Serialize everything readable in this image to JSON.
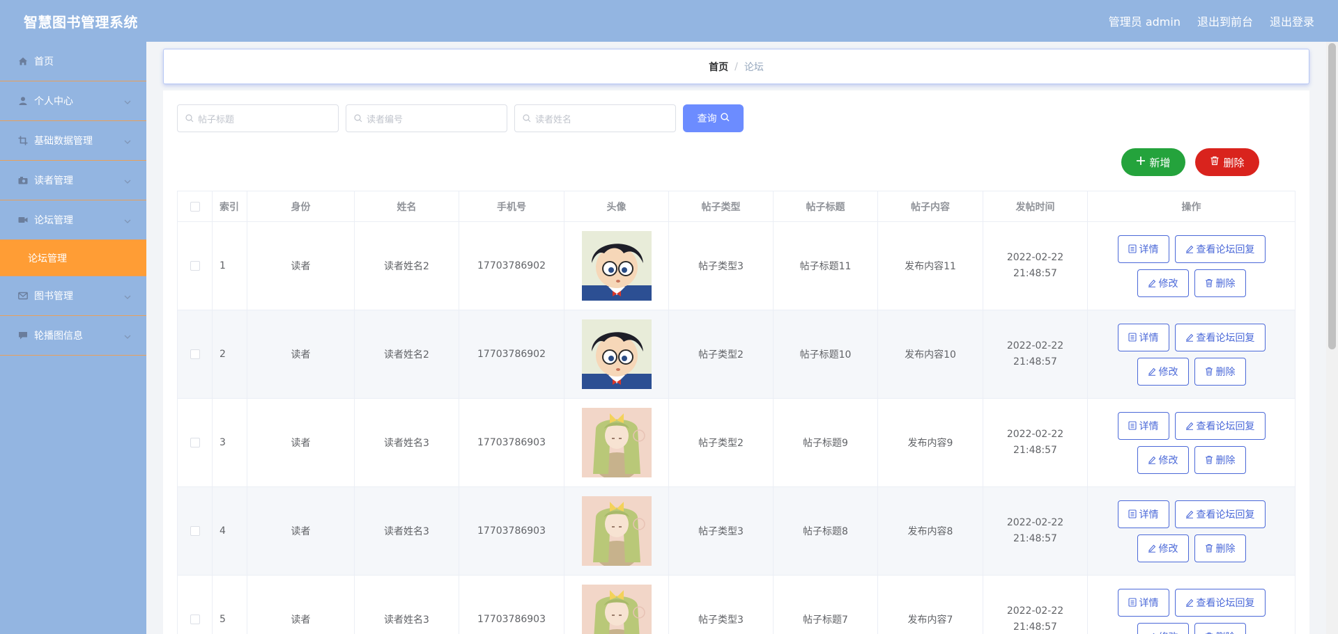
{
  "header": {
    "brand": "智慧图书管理系统",
    "admin": "管理员 admin",
    "front": "退出到前台",
    "logout": "退出登录"
  },
  "sidebar": {
    "items": [
      {
        "label": "首页",
        "icon": "home-icon",
        "has_chevron": false
      },
      {
        "label": "个人中心",
        "icon": "user-icon",
        "has_chevron": true
      },
      {
        "label": "基础数据管理",
        "icon": "crop-icon",
        "has_chevron": true
      },
      {
        "label": "读者管理",
        "icon": "camera-icon",
        "has_chevron": true
      },
      {
        "label": "论坛管理",
        "icon": "video-icon",
        "has_chevron": true
      },
      {
        "label": "图书管理",
        "icon": "mail-icon",
        "has_chevron": true
      },
      {
        "label": "轮播图信息",
        "icon": "chat-icon",
        "has_chevron": true
      }
    ],
    "active_sub": "论坛管理"
  },
  "breadcrumb": {
    "home": "首页",
    "separator": "/",
    "current": "论坛"
  },
  "search": {
    "title_placeholder": "帖子标题",
    "reader_id_placeholder": "读者编号",
    "reader_name_placeholder": "读者姓名",
    "query_label": "查询"
  },
  "actions": {
    "add_label": "新增",
    "delete_label": "删除"
  },
  "table": {
    "headers": {
      "index": "索引",
      "role": "身份",
      "name": "姓名",
      "phone": "手机号",
      "avatar": "头像",
      "type": "帖子类型",
      "title": "帖子标题",
      "content": "帖子内容",
      "time": "发帖时间",
      "ops": "操作"
    },
    "rows": [
      {
        "index": "1",
        "role": "读者",
        "name": "读者姓名2",
        "phone": "17703786902",
        "avatar": "boy",
        "type": "帖子类型3",
        "title": "帖子标题11",
        "content": "发布内容11",
        "time": "2022-02-22 21:48:57"
      },
      {
        "index": "2",
        "role": "读者",
        "name": "读者姓名2",
        "phone": "17703786902",
        "avatar": "boy",
        "type": "帖子类型2",
        "title": "帖子标题10",
        "content": "发布内容10",
        "time": "2022-02-22 21:48:57"
      },
      {
        "index": "3",
        "role": "读者",
        "name": "读者姓名3",
        "phone": "17703786903",
        "avatar": "girl",
        "type": "帖子类型2",
        "title": "帖子标题9",
        "content": "发布内容9",
        "time": "2022-02-22 21:48:57"
      },
      {
        "index": "4",
        "role": "读者",
        "name": "读者姓名3",
        "phone": "17703786903",
        "avatar": "girl",
        "type": "帖子类型3",
        "title": "帖子标题8",
        "content": "发布内容8",
        "time": "2022-02-22 21:48:57"
      },
      {
        "index": "5",
        "role": "读者",
        "name": "读者姓名3",
        "phone": "17703786903",
        "avatar": "girl",
        "type": "帖子类型3",
        "title": "帖子标题7",
        "content": "发布内容7",
        "time": "2022-02-22 21:48:57"
      }
    ],
    "op_labels": {
      "detail": "详情",
      "replies": "查看论坛回复",
      "edit": "修改",
      "delete": "删除"
    }
  },
  "colors": {
    "header_bg": "#93b5e1",
    "sidebar_active": "#ff9d35",
    "primary": "#6c8cff",
    "success": "#24a33c",
    "danger": "#d9231d"
  }
}
